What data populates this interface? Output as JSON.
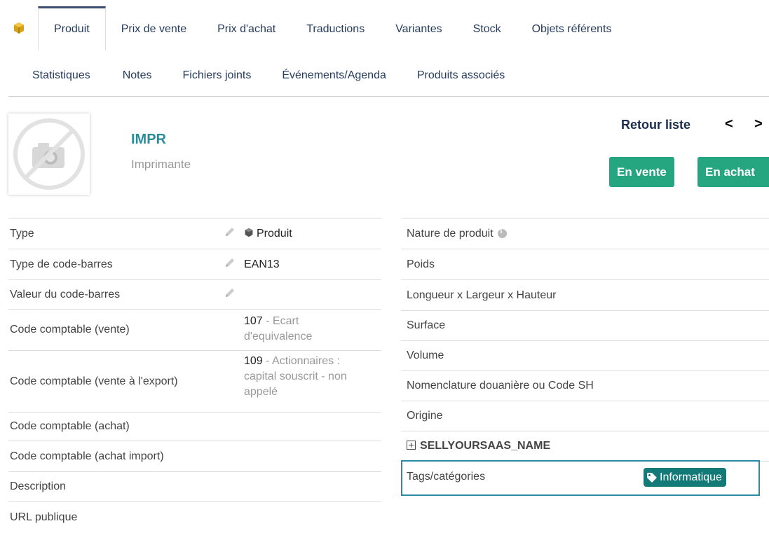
{
  "tabs_row1": [
    {
      "label": "Produit",
      "active": true
    },
    {
      "label": "Prix de vente"
    },
    {
      "label": "Prix d'achat"
    },
    {
      "label": "Traductions"
    },
    {
      "label": "Variantes"
    },
    {
      "label": "Stock"
    },
    {
      "label": "Objets référents"
    }
  ],
  "tabs_row2": [
    {
      "label": "Statistiques"
    },
    {
      "label": "Notes"
    },
    {
      "label": "Fichiers joints"
    },
    {
      "label": "Événements/Agenda"
    },
    {
      "label": "Produits associés"
    }
  ],
  "product": {
    "ref": "IMPR",
    "label": "Imprimante"
  },
  "nav": {
    "back_label": "Retour liste",
    "prev": "<",
    "next": ">"
  },
  "status_buttons": {
    "sell": "En vente",
    "buy": "En achat"
  },
  "left_fields": {
    "type": {
      "label": "Type",
      "value": "Produit"
    },
    "barcode_type": {
      "label": "Type de code-barres",
      "value": "EAN13"
    },
    "barcode_value": {
      "label": "Valeur du code-barres",
      "value": ""
    },
    "acct_sell": {
      "label": "Code comptable (vente)",
      "code": "107",
      "line1": " - Ecart",
      "line2": "d'equivalence"
    },
    "acct_export": {
      "label": "Code comptable (vente à l'export)",
      "code": "109",
      "line1": " - Actionnaires :",
      "line2": "capital souscrit - non",
      "line3": "appelé"
    },
    "acct_buy": {
      "label": "Code comptable (achat)"
    },
    "acct_import": {
      "label": "Code comptable (achat import)"
    },
    "description": {
      "label": "Description"
    },
    "public_url": {
      "label": "URL publique"
    }
  },
  "right_fields": {
    "nature": {
      "label": "Nature de produit"
    },
    "weight": {
      "label": "Poids"
    },
    "dimensions": {
      "label": "Longueur x Largeur x Hauteur"
    },
    "surface": {
      "label": "Surface"
    },
    "volume": {
      "label": "Volume"
    },
    "customs": {
      "label": "Nomenclature douanière ou Code SH"
    },
    "origin": {
      "label": "Origine"
    },
    "extrafield": {
      "label": "SELLYOURSAAS_NAME"
    },
    "tags": {
      "label": "Tags/catégories",
      "value": "Informatique"
    }
  },
  "colors": {
    "accent": "#25a580",
    "tag": "#137a78",
    "link": "#263c5c",
    "highlight": "#2a8aa6"
  }
}
